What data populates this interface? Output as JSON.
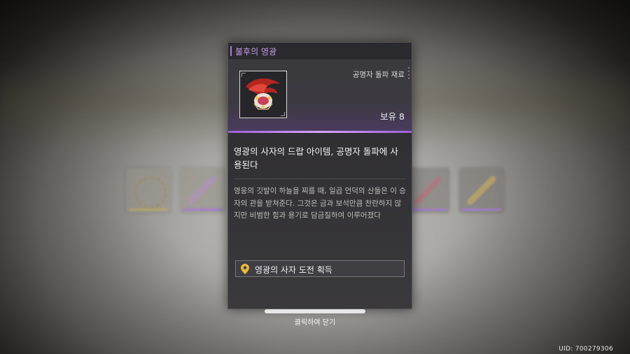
{
  "popup": {
    "title": "불후의 영광",
    "category": "공명자 돌파 재료",
    "owned": "보유 8",
    "summary": "영광의 사자의 드랍 아이템, 공명자 돌파에 사용된다",
    "lore": "영웅의 깃발이 하늘을 찌를 때, 일곱 언덕의 산들은 이 승자의 관을 받쳐준다. 그것은 금과 보석만큼 찬란하지 않지만 비범한 힘과 용기로 담금질하여 이루어졌다",
    "source": {
      "icon": "location-pin-icon",
      "label": "영광의 사자 도전 획득"
    }
  },
  "footer": {
    "close_hint": "클릭하여 닫기",
    "uid": "UID: 700279306"
  },
  "colors": {
    "accent": "#c89ce6",
    "rarity_glow": "#b27ad8",
    "pin": "#e9b73a"
  }
}
